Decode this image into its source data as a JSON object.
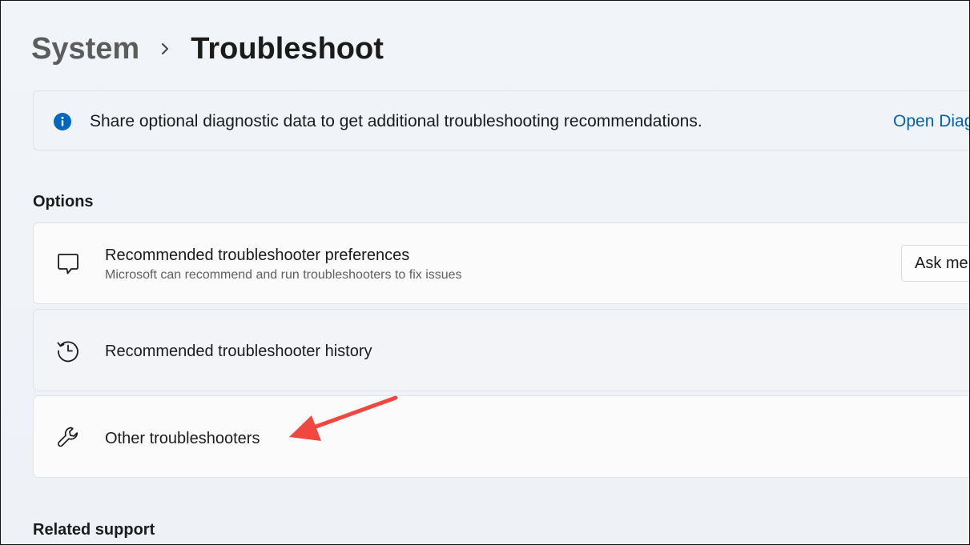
{
  "breadcrumb": {
    "parent": "System",
    "current": "Troubleshoot"
  },
  "banner": {
    "text": "Share optional diagnostic data to get additional troubleshooting recommendations.",
    "link": "Open Diag",
    "icon": "info-icon"
  },
  "sections": {
    "options_title": "Options",
    "related_title": "Related support"
  },
  "options": [
    {
      "title": "Recommended troubleshooter preferences",
      "subtitle": "Microsoft can recommend and run troubleshooters to fix issues",
      "icon": "chat-bubble-icon",
      "dropdown_value": "Ask me"
    },
    {
      "title": "Recommended troubleshooter history",
      "icon": "history-icon"
    },
    {
      "title": "Other troubleshooters",
      "icon": "wrench-icon"
    }
  ],
  "colors": {
    "accent": "#0063b1",
    "info_icon": "#0067c0",
    "annotation_arrow": "#f0483e"
  }
}
